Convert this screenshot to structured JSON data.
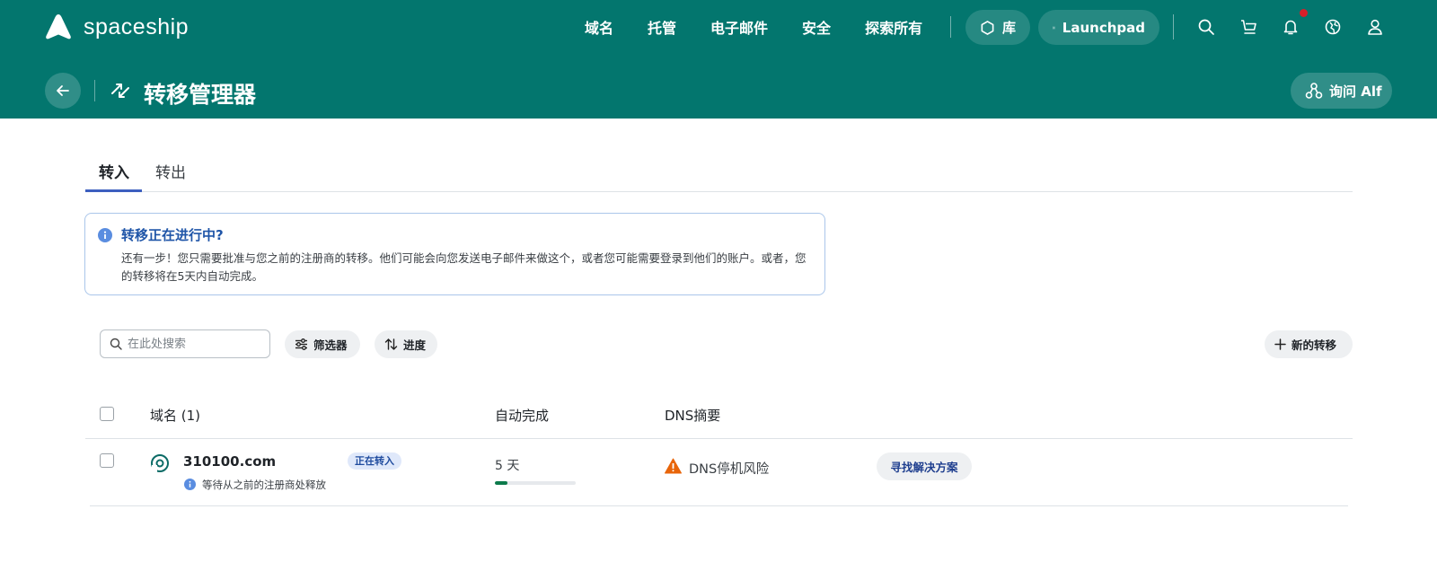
{
  "brand": {
    "name": "spaceship"
  },
  "nav": {
    "items": [
      "域名",
      "托管",
      "电子邮件",
      "安全",
      "探索所有"
    ],
    "library_label": "库",
    "launchpad_label": "Launchpad"
  },
  "header": {
    "title": "转移管理器",
    "ask_label": "询问 Alf"
  },
  "tabs": {
    "inbound": "转入",
    "outbound": "转出",
    "active": "inbound"
  },
  "notice": {
    "title": "转移正在进行中?",
    "body": "还有一步！您只需要批准与您之前的注册商的转移。他们可能会向您发送电子邮件来做这个，或者您可能需要登录到他们的账户。或者，您的转移将在5天内自动完成。"
  },
  "toolbar": {
    "search_placeholder": "在此处搜索",
    "filter_label": "筛选器",
    "progress_label": "进度",
    "new_transfer_label": "新的转移"
  },
  "table": {
    "columns": {
      "domain": "域名 (1)",
      "auto_complete": "自动完成",
      "dns_summary": "DNS摘要"
    },
    "rows": [
      {
        "domain": "310100.com",
        "status": "正在转入",
        "note": "等待从之前的注册商处释放",
        "days": "5 天",
        "progress_fraction": 0.15,
        "dns_status": "DNS停机风险",
        "action_label": "寻找解决方案"
      }
    ]
  },
  "colors": {
    "header_bg": "#03766e",
    "accent_blue": "#3d5fbf",
    "warning": "#e8650a",
    "progress": "#0c7a4b",
    "notification_dot": "#d6202a"
  }
}
